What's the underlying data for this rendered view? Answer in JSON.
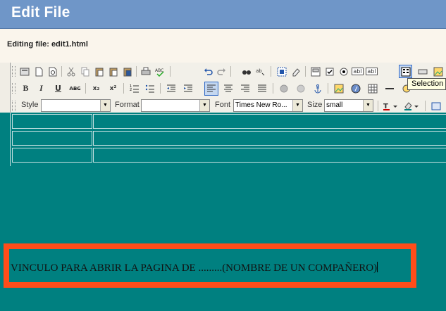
{
  "window": {
    "title": "Edit File"
  },
  "info": {
    "editing_label": "Editing file: edit1.html"
  },
  "toolbar": {
    "style_label": "Style",
    "style_value": "",
    "format_label": "Format",
    "format_value": "",
    "font_label": "Font",
    "font_value": "Times New Ro...",
    "size_label": "Size",
    "size_value": "small",
    "bold": "B",
    "italic": "I",
    "underline": "U",
    "strike": "ABC",
    "sub": "x₂",
    "sup": "x²",
    "text_field_icon_label": "abl",
    "text_area_icon_label": "abl"
  },
  "tooltip": {
    "text": "Selection"
  },
  "document": {
    "text": "VINCULO PARA ABRIR LA PAGINA DE .........(NOMBRE DE UN COMPAÑERO)",
    "background": "#008080",
    "highlight_color": "#ff4d1a"
  },
  "colors": {
    "titlebar": "#6f96c8",
    "toolbar": "#f2f0e9",
    "infobar": "#faf5ec"
  }
}
